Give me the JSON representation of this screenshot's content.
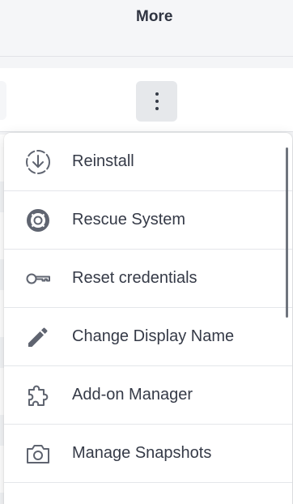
{
  "header": {
    "title": "More"
  },
  "toolbar": {
    "more_actions_icon": "vertical-ellipsis"
  },
  "menu": {
    "items": [
      {
        "label": "Reinstall",
        "icon": "reinstall-download-circle"
      },
      {
        "label": "Rescue System",
        "icon": "lifebuoy"
      },
      {
        "label": "Reset credentials",
        "icon": "key"
      },
      {
        "label": "Change Display Name",
        "icon": "pencil"
      },
      {
        "label": "Add-on Manager",
        "icon": "puzzle-piece"
      },
      {
        "label": "Manage Snapshots",
        "icon": "camera"
      }
    ]
  },
  "colors": {
    "text": "#353a47",
    "icon": "#5f6470",
    "divider": "#e4e6ea",
    "header_bg": "#f5f6f8"
  }
}
